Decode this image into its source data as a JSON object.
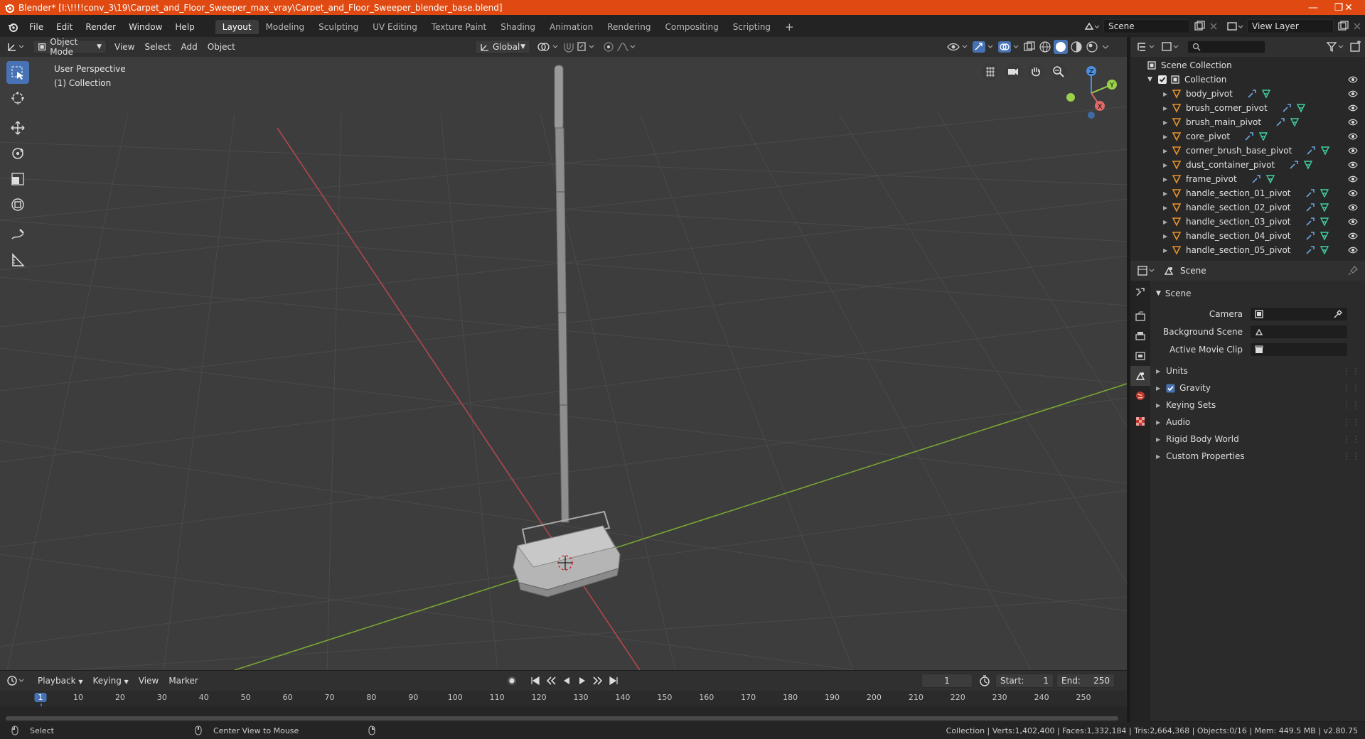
{
  "window": {
    "title": "Blender* [I:\\!!!!conv_3\\19\\Carpet_and_Floor_Sweeper_max_vray\\Carpet_and_Floor_Sweeper_blender_base.blend]",
    "accent": "#e04a12",
    "minimize": "—",
    "maximize": "❐",
    "close": "✕"
  },
  "menu": {
    "items": [
      "File",
      "Edit",
      "Render",
      "Window",
      "Help"
    ],
    "workspaces": [
      "Layout",
      "Modeling",
      "Sculpting",
      "UV Editing",
      "Texture Paint",
      "Shading",
      "Animation",
      "Rendering",
      "Compositing",
      "Scripting"
    ],
    "add_workspace": "+",
    "scene": "Scene",
    "view_layer": "View Layer"
  },
  "viewport_header": {
    "mode": "Object Mode",
    "menus": [
      "View",
      "Select",
      "Add",
      "Object"
    ],
    "orientation": "Global"
  },
  "viewport": {
    "perspective": "User Perspective",
    "collection": "(1) Collection",
    "gizmo": {
      "x": "X",
      "y": "Y",
      "z": "Z"
    }
  },
  "outliner": {
    "scene_collection": "Scene Collection",
    "collection": "Collection",
    "objects": [
      "body_pivot",
      "brush_corner_pivot",
      "brush_main_pivot",
      "core_pivot",
      "corner_brush_base_pivot",
      "dust_container_pivot",
      "frame_pivot",
      "handle_section_01_pivot",
      "handle_section_02_pivot",
      "handle_section_03_pivot",
      "handle_section_04_pivot",
      "handle_section_05_pivot"
    ]
  },
  "properties": {
    "context": "Scene",
    "panel_title": "Scene",
    "fields": {
      "camera": "Camera",
      "background_scene": "Background Scene",
      "active_movie_clip": "Active Movie Clip"
    },
    "subpanels": [
      "Units",
      "Gravity",
      "Keying Sets",
      "Audio",
      "Rigid Body World",
      "Custom Properties"
    ]
  },
  "timeline": {
    "menus": [
      "Playback",
      "Keying",
      "View",
      "Marker"
    ],
    "current_frame": "1",
    "start_label": "Start:",
    "start": "1",
    "end_label": "End:",
    "end": "250",
    "ticks": [
      "1",
      "10",
      "20",
      "30",
      "40",
      "50",
      "60",
      "70",
      "80",
      "90",
      "100",
      "110",
      "120",
      "130",
      "140",
      "150",
      "160",
      "170",
      "180",
      "190",
      "200",
      "210",
      "220",
      "230",
      "240",
      "250"
    ]
  },
  "status": {
    "select": "Select",
    "center_view": "Center View to Mouse",
    "stats": "Collection | Verts:1,402,400 | Faces:1,332,184 | Tris:2,664,368 | Objects:0/16 | Mem: 449.5 MB | v2.80.75"
  },
  "colors": {
    "x_axis": "#e06a6a",
    "y_axis": "#9bd14a",
    "z_axis": "#4a8ee0",
    "active_tool": "#4772b3"
  }
}
